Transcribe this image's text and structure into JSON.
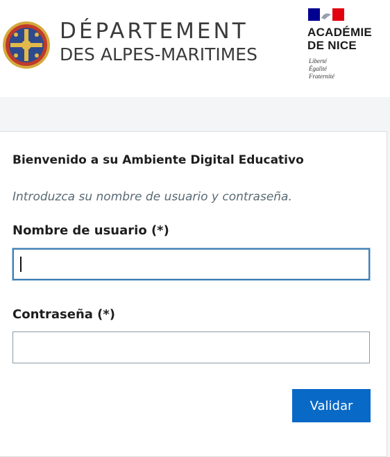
{
  "header": {
    "department": {
      "line1": "DÉPARTEMENT",
      "line2": "DES ALPES-MARITIMES"
    },
    "academie": {
      "line1": "ACADÉMIE",
      "line2": "DE NICE",
      "motto": [
        "Liberté",
        "Égalité",
        "Fraternité"
      ]
    }
  },
  "login": {
    "welcome": "Bienvenido a su Ambiente Digital Educativo",
    "intro": "Introduzca su nombre de usuario y contraseña.",
    "username_label": "Nombre de usuario  (*)",
    "username_value": "",
    "password_label": "Contraseña (*)",
    "password_value": "",
    "submit_label": "Validar"
  },
  "colors": {
    "primary_button": "#0969c6",
    "focus_border": "#3f7fb4",
    "page_background": "#f4f5f6",
    "rf_blue": "#000091",
    "rf_red": "#e1000f"
  }
}
